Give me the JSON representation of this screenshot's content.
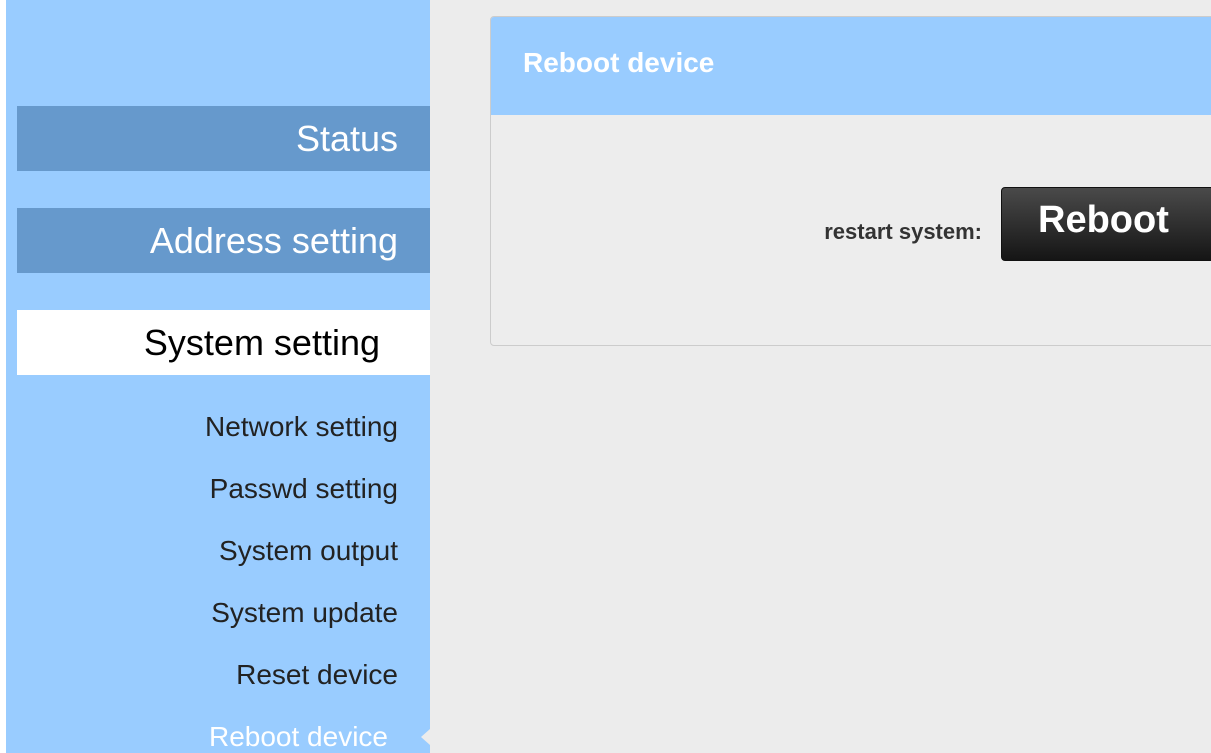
{
  "sidebar": {
    "main_items": [
      {
        "label": "Status",
        "active": false
      },
      {
        "label": "Address setting",
        "active": false
      },
      {
        "label": "System setting",
        "active": true
      }
    ],
    "sub_items": [
      {
        "label": "Network setting",
        "active": false
      },
      {
        "label": "Passwd setting",
        "active": false
      },
      {
        "label": "System output",
        "active": false
      },
      {
        "label": "System update",
        "active": false
      },
      {
        "label": "Reset device",
        "active": false
      },
      {
        "label": "Reboot device",
        "active": true
      }
    ]
  },
  "panel": {
    "title": "Reboot device",
    "restart_label": "restart system:",
    "reboot_button_label": "Reboot"
  },
  "colors": {
    "sidebar_bg": "#99ccff",
    "nav_main_bg": "#6699cc",
    "panel_header_bg": "#99ccff",
    "page_bg": "#ececec",
    "button_bg": "#2a2a2a"
  }
}
